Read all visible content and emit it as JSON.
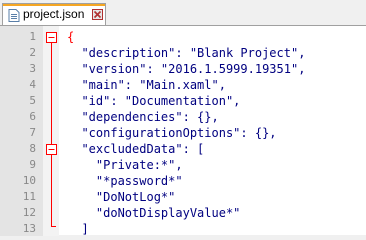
{
  "tab": {
    "label": "project.json"
  },
  "editor": {
    "line_numbers": [
      "1",
      "2",
      "3",
      "4",
      "5",
      "6",
      "7",
      "8",
      "9",
      "10",
      "11",
      "12",
      "13"
    ],
    "lines": [
      {
        "indent": "",
        "text": "{"
      },
      {
        "indent": "  ",
        "text": "\"description\": \"Blank Project\","
      },
      {
        "indent": "  ",
        "text": "\"version\": \"2016.1.5999.19351\","
      },
      {
        "indent": "  ",
        "text": "\"main\": \"Main.xaml\","
      },
      {
        "indent": "  ",
        "text": "\"id\": \"Documentation\","
      },
      {
        "indent": "  ",
        "text": "\"dependencies\": {},"
      },
      {
        "indent": "  ",
        "text": "\"configurationOptions\": {},"
      },
      {
        "indent": "  ",
        "text": "\"excludedData\": ["
      },
      {
        "indent": "    ",
        "text": "\"Private:*\","
      },
      {
        "indent": "    ",
        "text": "\"*password*\""
      },
      {
        "indent": "    ",
        "text": "\"DoNotLog*\""
      },
      {
        "indent": "    ",
        "text": "\"doNotDisplayValue*\""
      },
      {
        "indent": "  ",
        "text": "]"
      }
    ]
  },
  "colors": {
    "accent": "#f5a623",
    "fold_marker": "#ff0000",
    "string": "#000080"
  },
  "icons": {
    "file": "file-icon",
    "close": "close-icon",
    "fold": "fold-toggle-icon"
  }
}
